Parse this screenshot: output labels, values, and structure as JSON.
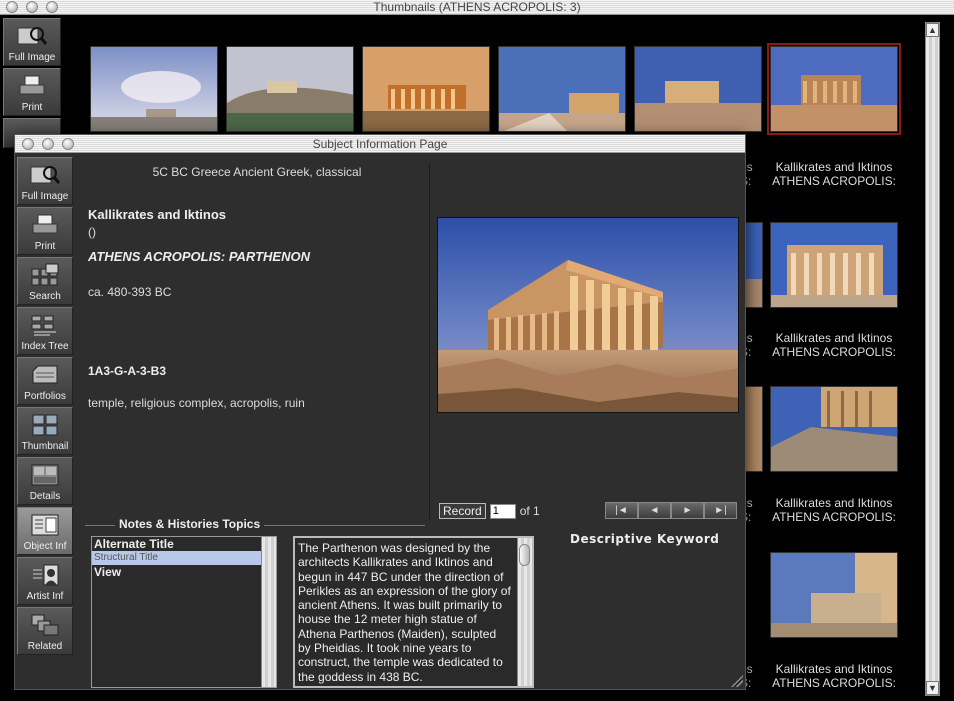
{
  "thumbnails_window": {
    "title": "Thumbnails (ATHENS ACROPOLIS: 3)",
    "toolbar": [
      {
        "label": "Full Image",
        "icon": "magnifier-icon"
      },
      {
        "label": "Print",
        "icon": "printer-icon"
      }
    ],
    "captions": [
      {
        "line1": "Kallikrates and Iktinos",
        "line2": "ATHENS ACROPOLIS:"
      },
      {
        "line1": "Kallikrates and Iktinos",
        "line2": "ATHENS ACROPOLIS:"
      },
      {
        "line1": "Kallikrates and Iktinos",
        "line2": "ATHENS ACROPOLIS:"
      },
      {
        "line1": "Kallikrates and Iktinos",
        "line2": "ATHENS ACROPOLIS:"
      }
    ],
    "partial_captions": [
      {
        "line1": "os",
        "line2": "S:"
      },
      {
        "line1": "os",
        "line2": "S:"
      },
      {
        "line1": "os",
        "line2": "S:"
      },
      {
        "line1": "os",
        "line2": "S:"
      }
    ]
  },
  "subject_window": {
    "title": "Subject Information Page",
    "toolbar": [
      {
        "label": "Full Image",
        "icon": "magnifier-icon"
      },
      {
        "label": "Print",
        "icon": "printer-icon"
      },
      {
        "label": "Search",
        "icon": "search-grid-icon"
      },
      {
        "label": "Index Tree",
        "icon": "index-tree-icon"
      },
      {
        "label": "Portfolios",
        "icon": "portfolio-icon"
      },
      {
        "label": "Thumbnail",
        "icon": "thumbnail-grid-icon"
      },
      {
        "label": "Details",
        "icon": "details-icon"
      },
      {
        "label": "Object Inf",
        "icon": "object-info-icon"
      },
      {
        "label": "Artist  Inf",
        "icon": "artist-info-icon"
      },
      {
        "label": "Related",
        "icon": "related-icon"
      }
    ],
    "period": "5C BC Greece Ancient Greek, classical",
    "artist": "Kallikrates and Iktinos",
    "artist_dates": "()",
    "work_title": "ATHENS ACROPOLIS: PARTHENON",
    "work_date": "ca. 480-393 BC",
    "catalog_number": "1A3-G-A-3-B3",
    "keywords": "temple, religious complex, acropolis, ruin",
    "record": {
      "label": "Record",
      "current": "1",
      "of_label": "of 1"
    },
    "nav": [
      "|◄",
      "◄",
      "►",
      "►|"
    ],
    "notes_header": "Notes & Histories Topics",
    "descriptive_keyword": "Descriptive Keyword",
    "topics": [
      "Alternate Title",
      "Structural Title",
      "View"
    ],
    "notes_text": "The Parthenon was designed by the architects Kallikrates and Iktinos and begun in 447 BC under the direction of Perikles as an expression of the glory of ancient Athens. It was built primarily to house the 12 meter high statue of Athena Parthenos (Maiden), sculpted by Pheidias.  It took nine years to construct, the temple was dedicated to the goddess in 438 BC."
  }
}
